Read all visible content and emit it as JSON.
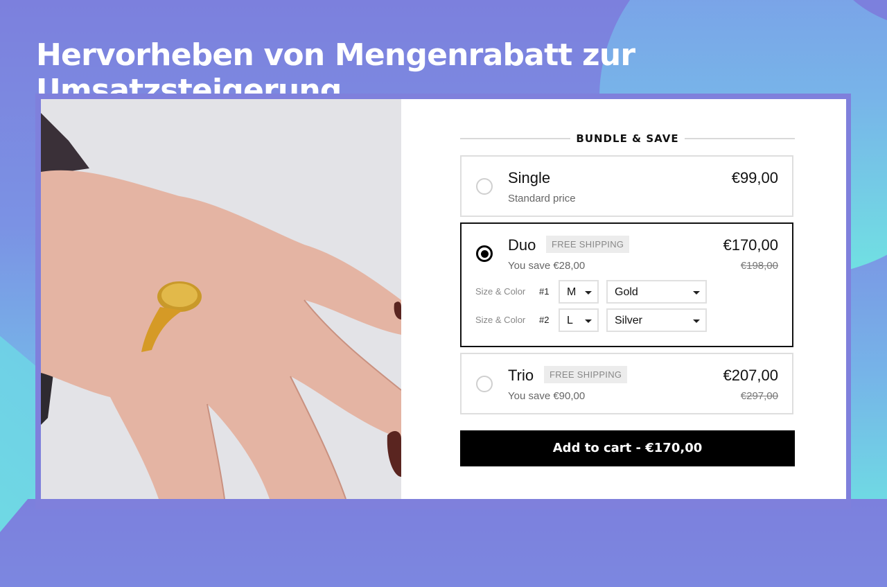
{
  "headline": "Hervorheben von Mengenrabatt zur Umsatzsteigerung",
  "product_image": {
    "alt": "hand-wearing-gold-signet-ring"
  },
  "widget": {
    "heading": "BUNDLE & SAVE",
    "options": [
      {
        "name": "Single",
        "subtitle": "Standard price",
        "badge": "",
        "price": "€99,00",
        "old_price": "",
        "selected": false
      },
      {
        "name": "Duo",
        "subtitle": "You save €28,00",
        "badge": "FREE SHIPPING",
        "price": "€170,00",
        "old_price": "€198,00",
        "selected": true,
        "variants": [
          {
            "label": "Size & Color",
            "index": "#1",
            "size": "M",
            "color": "Gold"
          },
          {
            "label": "Size & Color",
            "index": "#2",
            "size": "L",
            "color": "Silver"
          }
        ]
      },
      {
        "name": "Trio",
        "subtitle": "You save €90,00",
        "badge": "FREE SHIPPING",
        "price": "€207,00",
        "old_price": "€297,00",
        "selected": false
      }
    ],
    "add_to_cart": "Add to cart - €170,00"
  },
  "colors": {
    "accent": "#000000",
    "frame": "#7f80dc",
    "badge_bg": "#ececec"
  }
}
